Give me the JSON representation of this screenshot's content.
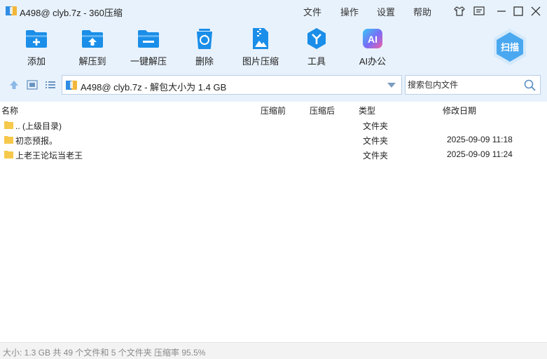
{
  "window": {
    "title": "A498@ clyb.7z - 360压缩",
    "menu": [
      "文件",
      "操作",
      "设置",
      "帮助"
    ]
  },
  "toolbar": {
    "items": [
      {
        "label": "添加",
        "icon": "add-folder-icon"
      },
      {
        "label": "解压到",
        "icon": "extract-to-icon"
      },
      {
        "label": "一键解压",
        "icon": "one-click-extract-icon"
      },
      {
        "label": "删除",
        "icon": "recycle-bin-icon"
      },
      {
        "label": "图片压缩",
        "icon": "image-compress-icon"
      },
      {
        "label": "工具",
        "icon": "tools-icon"
      },
      {
        "label": "AI办公",
        "icon": "ai-office-icon"
      }
    ],
    "scan_label": "扫描"
  },
  "address": {
    "path": "A498@ clyb.7z - 解包大小为 1.4 GB",
    "search_placeholder": "搜索包内文件"
  },
  "columns": {
    "name": "名称",
    "packed": "压缩前",
    "compressed": "压缩后",
    "type": "类型",
    "modified": "修改日期"
  },
  "rows": [
    {
      "name": ".. (上级目录)",
      "type": "文件夹",
      "modified": ""
    },
    {
      "name": "初恋预报。",
      "type": "文件夹",
      "modified": "2025-09-09 11:18"
    },
    {
      "name": "上老王论坛当老王",
      "type": "文件夹",
      "modified": "2025-09-09 11:24"
    }
  ],
  "status": "大小: 1.3 GB 共 49 个文件和 5 个文件夹 压缩率 95.5%",
  "colors": {
    "accent": "#1a8ee8",
    "toolbar_bg": "#e8f2fc",
    "folder": "#f6c84b"
  }
}
